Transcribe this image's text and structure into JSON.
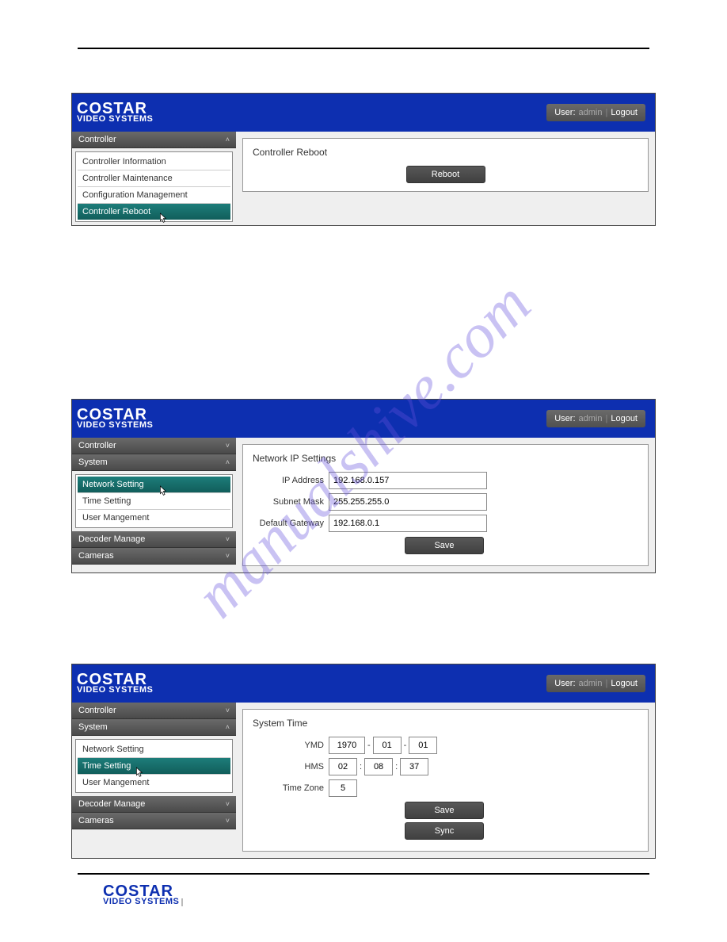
{
  "watermark": "manualshive.com",
  "brand": {
    "line1": "COSTAR",
    "line2": "VIDEO SYSTEMS"
  },
  "account": {
    "user_label": "User:",
    "user_value": "admin",
    "logout": "Logout"
  },
  "panel1": {
    "sidebar": {
      "section": "Controller",
      "items": [
        "Controller Information",
        "Controller Maintenance",
        "Configuration Management",
        "Controller Reboot"
      ],
      "selected": 3
    },
    "content": {
      "title": "Controller Reboot",
      "reboot_btn": "Reboot"
    }
  },
  "panel2": {
    "sidebar": {
      "sections": [
        "Controller",
        "System",
        "Decoder Manage",
        "Cameras"
      ],
      "system_items": [
        "Network Setting",
        "Time Setting",
        "User Mangement"
      ],
      "selected": 0
    },
    "content": {
      "title": "Network IP Settings",
      "ip_label": "IP Address",
      "ip_value": "192.168.0.157",
      "mask_label": "Subnet Mask",
      "mask_value": "255.255.255.0",
      "gw_label": "Default Gateway",
      "gw_value": "192.168.0.1",
      "save_btn": "Save"
    }
  },
  "panel3": {
    "sidebar": {
      "sections": [
        "Controller",
        "System",
        "Decoder Manage",
        "Cameras"
      ],
      "system_items": [
        "Network Setting",
        "Time Setting",
        "User Mangement"
      ],
      "selected": 1
    },
    "content": {
      "title": "System Time",
      "ymd_label": "YMD",
      "y": "1970",
      "m": "01",
      "d": "01",
      "hms_label": "HMS",
      "h": "02",
      "mi": "08",
      "s": "37",
      "tz_label": "Time Zone",
      "tz": "5",
      "save_btn": "Save",
      "sync_btn": "Sync"
    }
  }
}
